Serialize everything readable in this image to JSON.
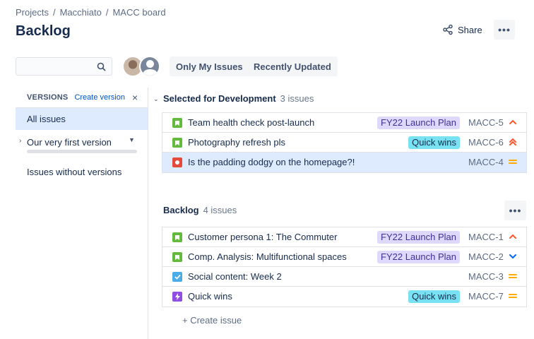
{
  "breadcrumb": [
    "Projects",
    "Macchiato",
    "MACC board"
  ],
  "page_title": "Backlog",
  "header": {
    "share_label": "Share",
    "more_label": "•••"
  },
  "search": {
    "placeholder": "",
    "value": ""
  },
  "filters": {
    "only_my_issues": "Only My Issues",
    "recently_updated": "Recently Updated"
  },
  "versions": {
    "title": "VERSIONS",
    "create_label": "Create version",
    "close_label": "×",
    "all_issues": "All issues",
    "items": [
      {
        "name": "Our very first version"
      }
    ],
    "without_versions": "Issues without versions"
  },
  "sprint": {
    "title": "Selected for Development",
    "count": "3 issues",
    "issues": [
      {
        "type": "story",
        "summary": "Team health check post-launch",
        "epic": "FY22 Launch Plan",
        "epic_color": "purple",
        "key": "MACC-5",
        "priority": "high"
      },
      {
        "type": "story",
        "summary": "Photography refresh pls",
        "epic": "Quick wins",
        "epic_color": "teal",
        "key": "MACC-6",
        "priority": "highest"
      },
      {
        "type": "bug",
        "summary": "Is the padding dodgy on the homepage?!",
        "epic": "",
        "epic_color": "",
        "key": "MACC-4",
        "priority": "medium"
      }
    ]
  },
  "backlog": {
    "title": "Backlog",
    "count": "4 issues",
    "more_label": "•••",
    "issues": [
      {
        "type": "story",
        "summary": "Customer persona 1: The Commuter",
        "epic": "FY22 Launch Plan",
        "epic_color": "purple",
        "key": "MACC-1",
        "priority": "high"
      },
      {
        "type": "story",
        "summary": "Comp. Analysis: Multifunctional spaces",
        "epic": "FY22 Launch Plan",
        "epic_color": "purple",
        "key": "MACC-2",
        "priority": "low"
      },
      {
        "type": "task",
        "summary": "Social content: Week 2",
        "epic": "",
        "epic_color": "",
        "key": "MACC-3",
        "priority": "medium"
      },
      {
        "type": "epic",
        "summary": "Quick wins",
        "epic": "Quick wins",
        "epic_color": "teal",
        "key": "MACC-7",
        "priority": "medium"
      }
    ],
    "create_issue": "+ Create issue"
  },
  "colors": {
    "story": "#63ba3c",
    "bug": "#e5493a",
    "task": "#4bade8",
    "epic": "#904ee2",
    "epic_purple_bg": "#dfd8fd",
    "epic_purple_fg": "#403294",
    "epic_teal_bg": "#79e2f2",
    "epic_teal_fg": "#172b4d",
    "priority_high": "#ff5630",
    "priority_highest": "#ff5630",
    "priority_medium": "#ffab00",
    "priority_low": "#0065ff"
  }
}
